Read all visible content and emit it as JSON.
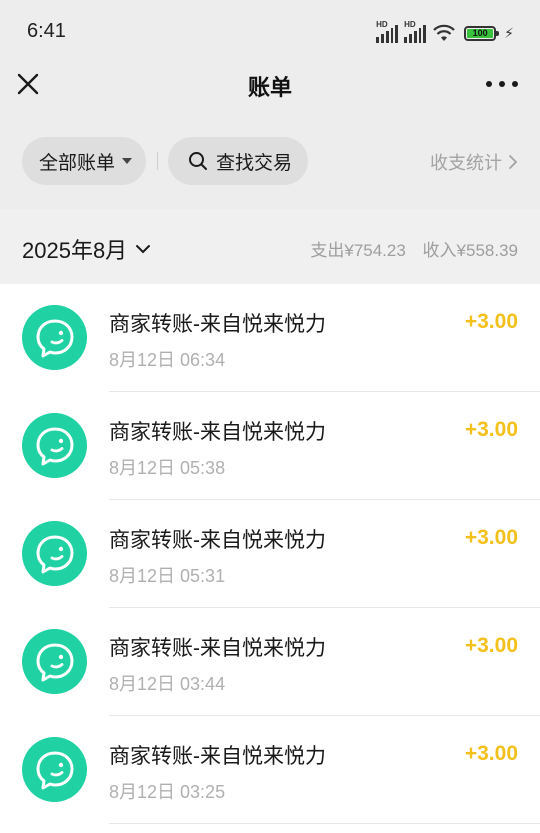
{
  "status_bar": {
    "time": "6:41",
    "signal_1_badge": "HD",
    "signal_2_badge": "HD",
    "battery_level": "100",
    "icons": [
      "signal-icon",
      "signal-icon",
      "wifi-icon",
      "battery-icon",
      "charging-icon"
    ]
  },
  "nav": {
    "title": "账单",
    "close_icon": "close-icon",
    "more_icon": "more-icon"
  },
  "filters": {
    "all_bills_label": "全部账单",
    "search_label": "查找交易",
    "stats_label": "收支统计"
  },
  "month": {
    "label": "2025年8月",
    "expense": "支出¥754.23",
    "income": "收入¥558.39"
  },
  "colors": {
    "accent_green": "#1fd1a3",
    "income_amount": "#f4c01c",
    "header_bg": "#ededed"
  },
  "transactions": [
    {
      "title": "商家转账-来自悦来悦力",
      "time": "8月12日 06:34",
      "amount": "+3.00",
      "icon": "chat-smile-icon"
    },
    {
      "title": "商家转账-来自悦来悦力",
      "time": "8月12日 05:38",
      "amount": "+3.00",
      "icon": "chat-smile-icon"
    },
    {
      "title": "商家转账-来自悦来悦力",
      "time": "8月12日 05:31",
      "amount": "+3.00",
      "icon": "chat-smile-icon"
    },
    {
      "title": "商家转账-来自悦来悦力",
      "time": "8月12日 03:44",
      "amount": "+3.00",
      "icon": "chat-smile-icon"
    },
    {
      "title": "商家转账-来自悦来悦力",
      "time": "8月12日 03:25",
      "amount": "+3.00",
      "icon": "chat-smile-icon"
    }
  ]
}
